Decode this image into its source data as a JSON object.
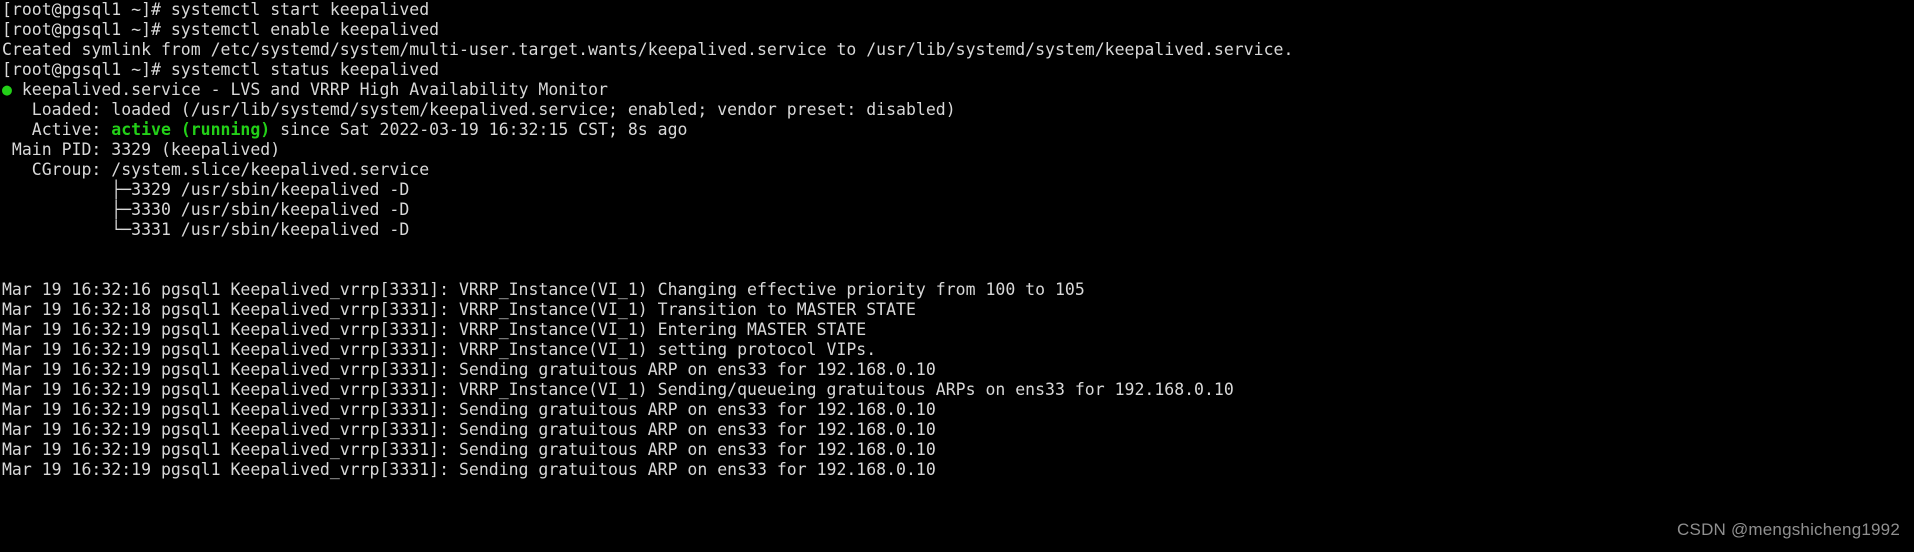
{
  "terminal": {
    "prompt": "[root@pgsql1 ~]#",
    "colors": {
      "background": "#000000",
      "foreground": "#d8d8d8",
      "green": "#23d018",
      "watermark": "#8f8f8f"
    },
    "lines": [
      {
        "id": "cmd-start",
        "segments": [
          {
            "text": "[root@pgsql1 ~]# systemctl start keepalived",
            "style": "normal"
          }
        ]
      },
      {
        "id": "cmd-enable",
        "segments": [
          {
            "text": "[root@pgsql1 ~]# systemctl enable keepalived",
            "style": "normal"
          }
        ]
      },
      {
        "id": "symlink-output",
        "segments": [
          {
            "text": "Created symlink from /etc/systemd/system/multi-user.target.wants/keepalived.service to /usr/lib/systemd/system/keepalived.service.",
            "style": "normal"
          }
        ]
      },
      {
        "id": "cmd-status",
        "segments": [
          {
            "text": "[root@pgsql1 ~]# systemctl status keepalived",
            "style": "normal"
          }
        ]
      },
      {
        "id": "unit-header",
        "segments": [
          {
            "text": "●",
            "style": "dot"
          },
          {
            "text": " keepalived.service - LVS and VRRP High Availability Monitor",
            "style": "normal"
          }
        ]
      },
      {
        "id": "unit-loaded",
        "segments": [
          {
            "text": "   Loaded: loaded (/usr/lib/systemd/system/keepalived.service; enabled; vendor preset: disabled)",
            "style": "normal"
          }
        ]
      },
      {
        "id": "unit-active",
        "segments": [
          {
            "text": "   Active: ",
            "style": "normal"
          },
          {
            "text": "active (running)",
            "style": "green-bold"
          },
          {
            "text": " since Sat 2022-03-19 16:32:15 CST; 8s ago",
            "style": "normal"
          }
        ]
      },
      {
        "id": "unit-mainpid",
        "segments": [
          {
            "text": " Main PID: 3329 (keepalived)",
            "style": "normal"
          }
        ]
      },
      {
        "id": "unit-cgroup",
        "segments": [
          {
            "text": "   CGroup: /system.slice/keepalived.service",
            "style": "normal"
          }
        ]
      },
      {
        "id": "cgroup-proc-3329",
        "segments": [
          {
            "text": "           ├─3329 /usr/sbin/keepalived -D",
            "style": "normal"
          }
        ]
      },
      {
        "id": "cgroup-proc-3330",
        "segments": [
          {
            "text": "           ├─3330 /usr/sbin/keepalived -D",
            "style": "normal"
          }
        ]
      },
      {
        "id": "cgroup-proc-3331",
        "segments": [
          {
            "text": "           └─3331 /usr/sbin/keepalived -D",
            "style": "normal"
          }
        ]
      },
      {
        "id": "spacer-1",
        "segments": [
          {
            "text": " ",
            "style": "normal"
          }
        ]
      },
      {
        "id": "spacer-2",
        "segments": [
          {
            "text": " ",
            "style": "normal"
          }
        ]
      },
      {
        "id": "log-1",
        "segments": [
          {
            "text": "Mar 19 16:32:16 pgsql1 Keepalived_vrrp[3331]: VRRP_Instance(VI_1) Changing effective priority from 100 to 105",
            "style": "normal"
          }
        ]
      },
      {
        "id": "log-2",
        "segments": [
          {
            "text": "Mar 19 16:32:18 pgsql1 Keepalived_vrrp[3331]: VRRP_Instance(VI_1) Transition to MASTER STATE",
            "style": "normal"
          }
        ]
      },
      {
        "id": "log-3",
        "segments": [
          {
            "text": "Mar 19 16:32:19 pgsql1 Keepalived_vrrp[3331]: VRRP_Instance(VI_1) Entering MASTER STATE",
            "style": "normal"
          }
        ]
      },
      {
        "id": "log-4",
        "segments": [
          {
            "text": "Mar 19 16:32:19 pgsql1 Keepalived_vrrp[3331]: VRRP_Instance(VI_1) setting protocol VIPs.",
            "style": "normal"
          }
        ]
      },
      {
        "id": "log-5",
        "segments": [
          {
            "text": "Mar 19 16:32:19 pgsql1 Keepalived_vrrp[3331]: Sending gratuitous ARP on ens33 for 192.168.0.10",
            "style": "normal"
          }
        ]
      },
      {
        "id": "log-6",
        "segments": [
          {
            "text": "Mar 19 16:32:19 pgsql1 Keepalived_vrrp[3331]: VRRP_Instance(VI_1) Sending/queueing gratuitous ARPs on ens33 for 192.168.0.10",
            "style": "normal"
          }
        ]
      },
      {
        "id": "log-7",
        "segments": [
          {
            "text": "Mar 19 16:32:19 pgsql1 Keepalived_vrrp[3331]: Sending gratuitous ARP on ens33 for 192.168.0.10",
            "style": "normal"
          }
        ]
      },
      {
        "id": "log-8",
        "segments": [
          {
            "text": "Mar 19 16:32:19 pgsql1 Keepalived_vrrp[3331]: Sending gratuitous ARP on ens33 for 192.168.0.10",
            "style": "normal"
          }
        ]
      },
      {
        "id": "log-9",
        "segments": [
          {
            "text": "Mar 19 16:32:19 pgsql1 Keepalived_vrrp[3331]: Sending gratuitous ARP on ens33 for 192.168.0.10",
            "style": "normal"
          }
        ]
      },
      {
        "id": "log-10",
        "segments": [
          {
            "text": "Mar 19 16:32:19 pgsql1 Keepalived_vrrp[3331]: Sending gratuitous ARP on ens33 for 192.168.0.10",
            "style": "normal"
          }
        ]
      }
    ],
    "watermark": "CSDN @mengshicheng1992"
  }
}
